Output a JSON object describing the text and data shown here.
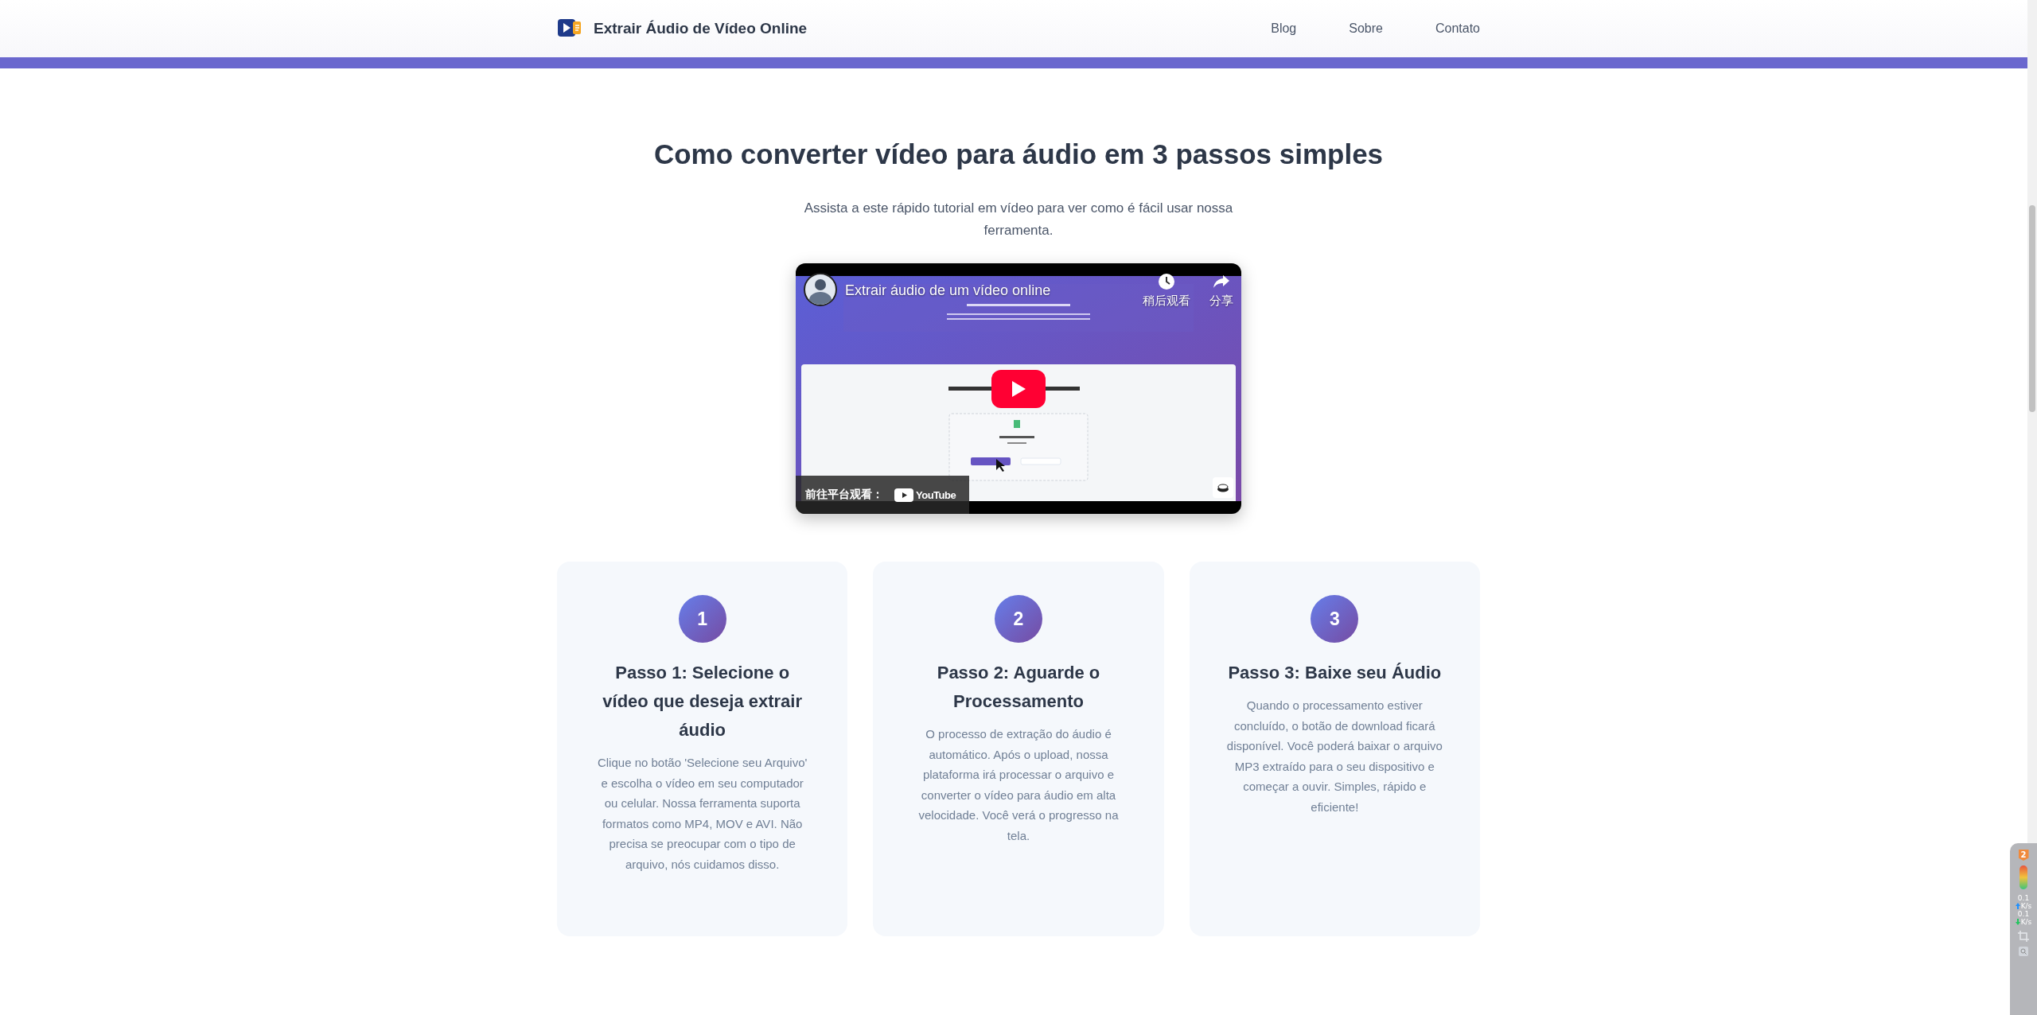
{
  "header": {
    "title": "Extrair Áudio de Vídeo Online",
    "nav": [
      "Blog",
      "Sobre",
      "Contato"
    ]
  },
  "section": {
    "title": "Como converter vídeo para áudio em 3 passos simples",
    "subtitle": "Assista a este rápido tutorial em vídeo para ver como é fácil usar nossa ferramenta."
  },
  "video": {
    "title": "Extrair áudio de um vídeo online",
    "actions": [
      {
        "kind": "watch_later",
        "label": "稍后观看"
      },
      {
        "kind": "share",
        "label": "分享"
      }
    ],
    "watch_on": "前往平台观看：",
    "platform": "YouTube"
  },
  "steps": [
    {
      "number": "1",
      "title": "Passo 1: Selecione o vídeo que deseja extrair áudio",
      "text": "Clique no botão 'Selecione seu Arquivo' e escolha o vídeo em seu computador ou celular. Nossa ferramenta suporta formatos como MP4, MOV e AVI. Não precisa se preocupar com o tipo de arquivo, nós cuidamos disso."
    },
    {
      "number": "2",
      "title": "Passo 2: Aguarde o Processamento",
      "text": "O processo de extração do áudio é automático. Após o upload, nossa plataforma irá processar o arquivo e converter o vídeo para áudio em alta velocidade. Você verá o progresso na tela."
    },
    {
      "number": "3",
      "title": "Passo 3: Baixe seu Áudio",
      "text": "Quando o processamento estiver concluído, o botão de download ficará disponível. Você poderá baixar o arquivo MP3 extraído para o seu dispositivo e começar a ouvir. Simples, rápido e eficiente!"
    }
  ],
  "speed_widget": {
    "badge": "2",
    "rates": [
      {
        "kind": "upload",
        "value": "0.1",
        "unit": "K/s"
      },
      {
        "kind": "download",
        "value": "0.1",
        "unit": "K/s"
      }
    ]
  }
}
